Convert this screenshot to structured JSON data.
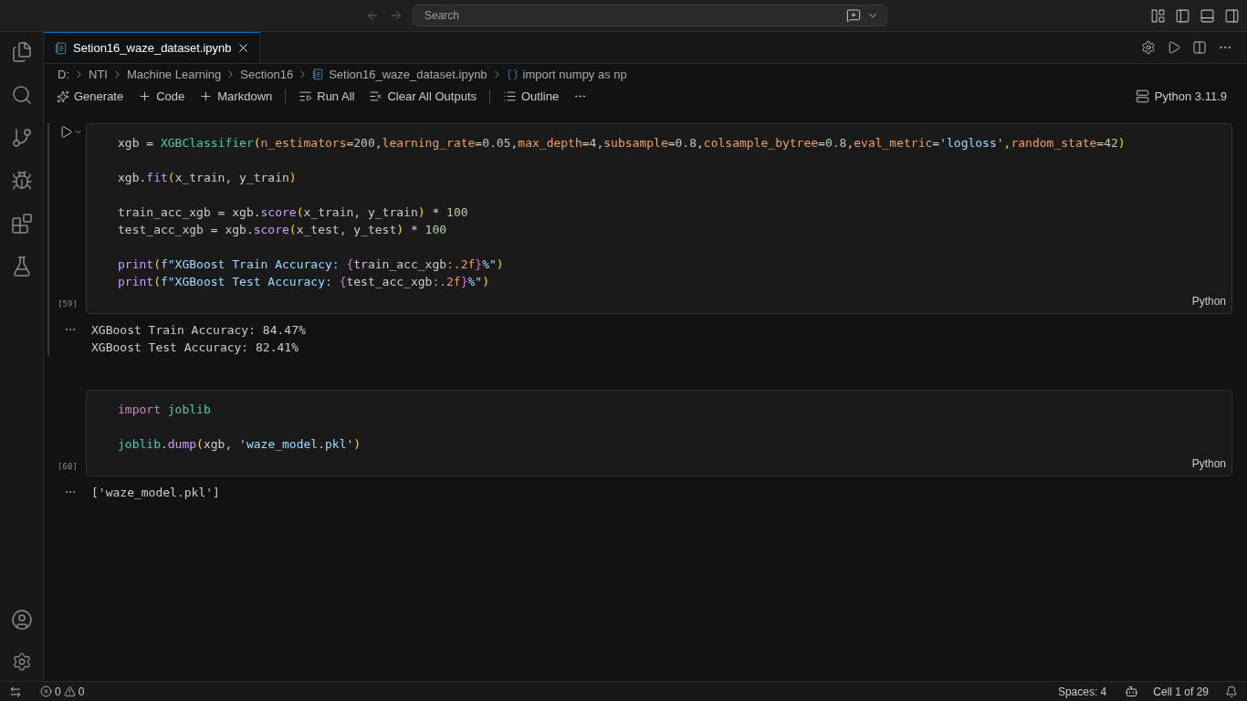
{
  "search": {
    "placeholder": "Search"
  },
  "tab": {
    "label": "Setion16_waze_dataset.ipynb",
    "selected": true
  },
  "breadcrumbs": [
    {
      "kind": "folder",
      "label": "D:"
    },
    {
      "kind": "folder",
      "label": "NTI"
    },
    {
      "kind": "folder",
      "label": "Machine Learning"
    },
    {
      "kind": "folder",
      "label": "Section16"
    },
    {
      "kind": "file",
      "label": "Setion16_waze_dataset.ipynb"
    },
    {
      "kind": "symbol",
      "label": "import numpy as np"
    }
  ],
  "toolbar": [
    {
      "kind": "generate",
      "label": "Generate"
    },
    {
      "kind": "add",
      "label": "Code"
    },
    {
      "kind": "add",
      "label": "Markdown"
    },
    {
      "kind": "run",
      "label": "Run All"
    },
    {
      "kind": "clear",
      "label": "Clear All Outputs"
    },
    {
      "kind": "outline",
      "label": "Outline"
    }
  ],
  "kernel": "Python 3.11.9",
  "cells": [
    {
      "focused": true,
      "exec": "[59]",
      "language": "Python",
      "blocks": [
        [
          [
            {
              "kind": "v",
              "text": "xgb = "
            },
            {
              "kind": "cls",
              "text": "XGBClassifier"
            },
            {
              "kind": "p",
              "text": "("
            },
            {
              "kind": "a",
              "text": "n_estimators"
            },
            {
              "kind": "v",
              "text": "="
            },
            {
              "kind": "n",
              "text": "200"
            },
            {
              "kind": "v",
              "text": ","
            },
            {
              "kind": "a",
              "text": "learning_rate"
            },
            {
              "kind": "v",
              "text": "="
            },
            {
              "kind": "n",
              "text": "0.05"
            },
            {
              "kind": "v",
              "text": ","
            },
            {
              "kind": "a",
              "text": "max_depth"
            },
            {
              "kind": "v",
              "text": "="
            },
            {
              "kind": "n",
              "text": "4"
            },
            {
              "kind": "v",
              "text": ","
            },
            {
              "kind": "a",
              "text": "subsample"
            },
            {
              "kind": "v",
              "text": "="
            },
            {
              "kind": "n",
              "text": "0.8"
            },
            {
              "kind": "v",
              "text": ","
            },
            {
              "kind": "a",
              "text": "colsample_bytree"
            },
            {
              "kind": "v",
              "text": "="
            },
            {
              "kind": "n",
              "text": "0.8"
            },
            {
              "kind": "v",
              "text": ","
            },
            {
              "kind": "a",
              "text": "eval_metric"
            },
            {
              "kind": "v",
              "text": "="
            },
            {
              "kind": "s",
              "text": "'logloss'"
            },
            {
              "kind": "v",
              "text": ","
            },
            {
              "kind": "a",
              "text": "random_state"
            },
            {
              "kind": "v",
              "text": "="
            },
            {
              "kind": "n",
              "text": "42"
            },
            {
              "kind": "p",
              "text": ")"
            }
          ]
        ],
        [
          [
            {
              "kind": "v",
              "text": "xgb."
            },
            {
              "kind": "f",
              "text": "fit"
            },
            {
              "kind": "p",
              "text": "("
            },
            {
              "kind": "v",
              "text": "x_train, y_train"
            },
            {
              "kind": "p",
              "text": ")"
            }
          ]
        ],
        [
          [
            {
              "kind": "v",
              "text": "train_acc_xgb = xgb."
            },
            {
              "kind": "f",
              "text": "score"
            },
            {
              "kind": "p",
              "text": "("
            },
            {
              "kind": "v",
              "text": "x_train, y_train"
            },
            {
              "kind": "p",
              "text": ")"
            },
            {
              "kind": "v",
              "text": " * "
            },
            {
              "kind": "n",
              "text": "100"
            }
          ],
          [
            {
              "kind": "v",
              "text": "test_acc_xgb = xgb."
            },
            {
              "kind": "f",
              "text": "score"
            },
            {
              "kind": "p",
              "text": "("
            },
            {
              "kind": "v",
              "text": "x_test, y_test"
            },
            {
              "kind": "p",
              "text": ")"
            },
            {
              "kind": "v",
              "text": " * "
            },
            {
              "kind": "n",
              "text": "100"
            }
          ]
        ],
        [
          [
            {
              "kind": "f",
              "text": "print"
            },
            {
              "kind": "p",
              "text": "("
            },
            {
              "kind": "s",
              "text": "f\"XGBoost Train Accuracy: "
            },
            {
              "kind": "b",
              "text": "{"
            },
            {
              "kind": "v",
              "text": "train_acc_xgb"
            },
            {
              "kind": "a",
              "text": ":.2f"
            },
            {
              "kind": "b",
              "text": "}"
            },
            {
              "kind": "s",
              "text": "%\""
            },
            {
              "kind": "p",
              "text": ")"
            }
          ],
          [
            {
              "kind": "f",
              "text": "print"
            },
            {
              "kind": "p",
              "text": "("
            },
            {
              "kind": "s",
              "text": "f\"XGBoost Test Accuracy: "
            },
            {
              "kind": "b",
              "text": "{"
            },
            {
              "kind": "v",
              "text": "test_acc_xgb"
            },
            {
              "kind": "a",
              "text": ":.2f"
            },
            {
              "kind": "b",
              "text": "}"
            },
            {
              "kind": "s",
              "text": "%\""
            },
            {
              "kind": "p",
              "text": ")"
            }
          ]
        ]
      ],
      "output": [
        "XGBoost Train Accuracy: 84.47%",
        "XGBoost Test Accuracy: 82.41%"
      ]
    },
    {
      "focused": false,
      "exec": "[60]",
      "language": "Python",
      "blocks": [
        [
          [
            {
              "kind": "k",
              "text": "import "
            },
            {
              "kind": "cls",
              "text": "joblib"
            }
          ]
        ],
        [
          [
            {
              "kind": "cls",
              "text": "joblib"
            },
            {
              "kind": "v",
              "text": "."
            },
            {
              "kind": "f",
              "text": "dump"
            },
            {
              "kind": "p",
              "text": "("
            },
            {
              "kind": "v",
              "text": "xgb, "
            },
            {
              "kind": "s",
              "text": "'waze_model.pkl'"
            },
            {
              "kind": "p",
              "text": ")"
            }
          ]
        ]
      ],
      "output": [
        "['waze_model.pkl']"
      ]
    }
  ],
  "status": {
    "errors": "0",
    "warnings": "0",
    "spaces": "Spaces: 4",
    "cell": "Cell 1 of 29"
  }
}
